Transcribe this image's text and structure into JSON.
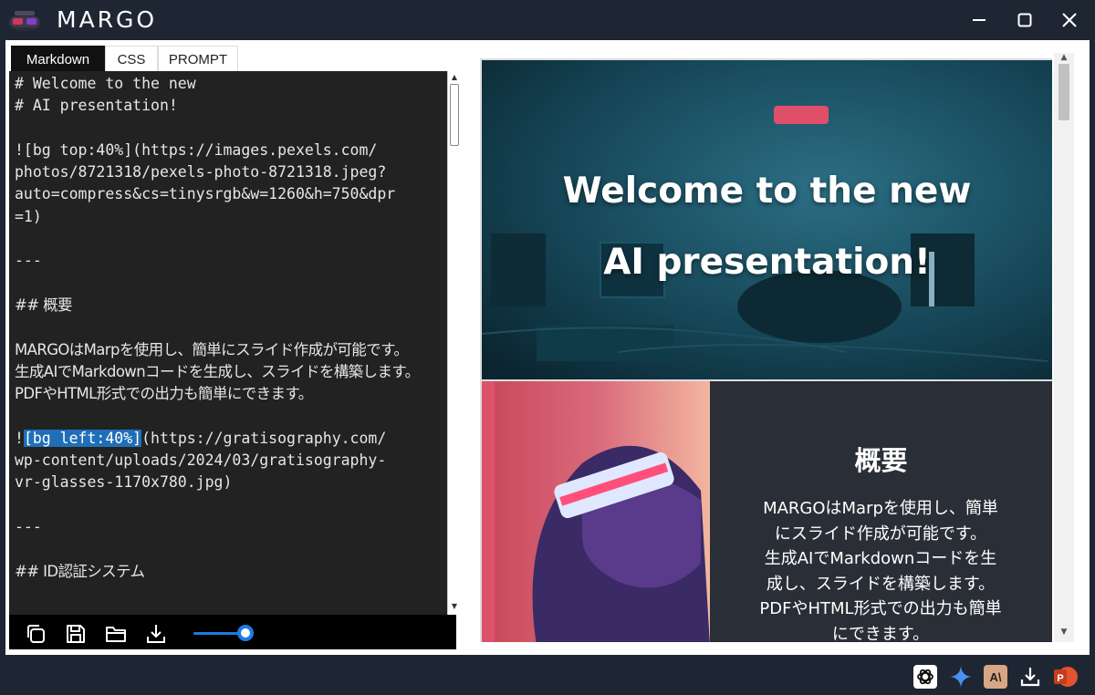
{
  "app": {
    "title": "MARGO"
  },
  "window_controls": [
    "minimize-icon",
    "maximize-icon",
    "close-icon"
  ],
  "tabs": [
    {
      "label": "Markdown",
      "active": true
    },
    {
      "label": "CSS",
      "active": false
    },
    {
      "label": "PROMPT",
      "active": false
    }
  ],
  "editor": {
    "lines": [
      "# Welcome to the new",
      "# AI presentation!",
      "",
      "![bg top:40%](https://images.pexels.com/",
      "photos/8721318/pexels-photo-8721318.jpeg?",
      "auto=compress&cs=tinysrgb&w=1260&h=750&dpr",
      "=1)",
      "",
      "---",
      "",
      "## 概要",
      "",
      "MARGOはMarpを使用し、簡単にスライド作成が可能です。",
      "生成AIでMarkdownコードを生成し、スライドを構築します。",
      "PDFやHTML形式での出力も簡単にできます。",
      "",
      "!",
      "wp-content/uploads/2024/03/gratisography-",
      "vr-glasses-1170x780.jpg)",
      "",
      "---",
      "",
      "## ID認証システム"
    ],
    "line16_selected": "[bg left:40%]",
    "line16_rest": "(https://gratisography.com/"
  },
  "toolbar": {
    "icons": [
      "copy-icon",
      "save-icon",
      "folder-icon",
      "download-icon"
    ],
    "zoom_slider_value": 0.85
  },
  "preview": {
    "slide1": {
      "title_line1": "Welcome to the new",
      "title_line2": "AI presentation!"
    },
    "slide2": {
      "heading": "概要",
      "body_line1": "MARGOはMarpを使用し、簡単",
      "body_line2": "にスライド作成が可能です。",
      "body_line3": "生成AIでMarkdownコードを生",
      "body_line4": "成し、スライドを構築します。",
      "body_line5": "PDFやHTML形式での出力も簡単",
      "body_line6": "にできます。"
    }
  },
  "bottom_icons": [
    "chatgpt-icon",
    "gemini-icon",
    "anthropic-icon",
    "download-icon",
    "powerpoint-icon"
  ],
  "bottom_labels": {
    "anthropic": "A\\",
    "powerpoint": "P"
  },
  "colors": {
    "background": "#1f2633",
    "editor_bg": "#222222",
    "selection": "#1f6fb8",
    "slider_accent": "#1e7ae6",
    "slide_dark": "#2a2f37"
  }
}
